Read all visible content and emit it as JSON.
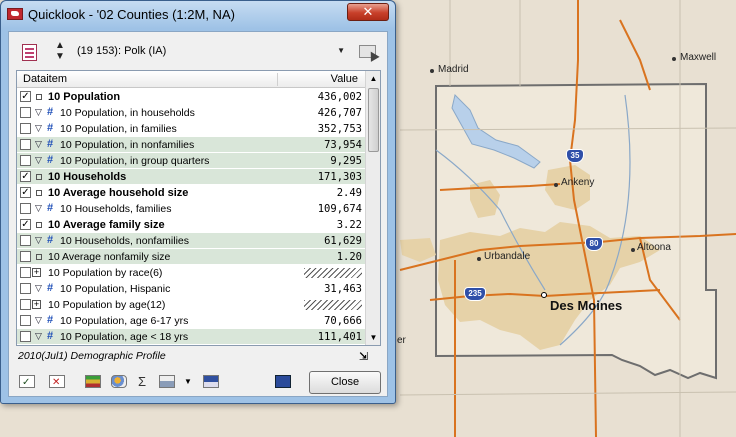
{
  "window": {
    "title": "Quicklook - '02 Counties (1:2M, NA)",
    "close_glyph": "✕"
  },
  "selector": {
    "value": "(19 153): Polk (IA)",
    "spin_up": "▲",
    "spin_down": "▼",
    "dropdown_arrow": "▼"
  },
  "grid": {
    "header_item": "Dataitem",
    "header_value": "Value",
    "rows": [
      {
        "checked": true,
        "expand": "",
        "icon": "sq",
        "label": "10 Population",
        "value": "436,002",
        "bold": true,
        "shade": false
      },
      {
        "checked": false,
        "expand": "▽",
        "icon": "hash",
        "label": "10 Population, in households",
        "value": "426,707",
        "bold": false,
        "shade": false
      },
      {
        "checked": false,
        "expand": "▽",
        "icon": "hash",
        "label": "10 Population, in families",
        "value": "352,753",
        "bold": false,
        "shade": false
      },
      {
        "checked": false,
        "expand": "▽",
        "icon": "hash",
        "label": "10 Population, in nonfamilies",
        "value": "73,954",
        "bold": false,
        "shade": true
      },
      {
        "checked": false,
        "expand": "▽",
        "icon": "hash",
        "label": "10 Population, in group quarters",
        "value": "9,295",
        "bold": false,
        "shade": true
      },
      {
        "checked": true,
        "expand": "",
        "icon": "sq",
        "label": "10 Households",
        "value": "171,303",
        "bold": true,
        "shade": true
      },
      {
        "checked": true,
        "expand": "",
        "icon": "sq",
        "label": "10 Average household size",
        "value": "2.49",
        "bold": true,
        "shade": false
      },
      {
        "checked": false,
        "expand": "▽",
        "icon": "hash",
        "label": "10 Households, families",
        "value": "109,674",
        "bold": false,
        "shade": false
      },
      {
        "checked": true,
        "expand": "",
        "icon": "sq",
        "label": "10 Average family size",
        "value": "3.22",
        "bold": true,
        "shade": false
      },
      {
        "checked": false,
        "expand": "▽",
        "icon": "hash",
        "label": "10 Households, nonfamilies",
        "value": "61,629",
        "bold": false,
        "shade": true
      },
      {
        "checked": false,
        "expand": "",
        "icon": "sq",
        "label": "10 Average nonfamily size",
        "value": "1.20",
        "bold": false,
        "shade": true,
        "plain": true
      },
      {
        "checked": false,
        "expand": "",
        "icon": "plus",
        "label": "10 Population by race(6)",
        "value": "",
        "bold": false,
        "shade": false,
        "plain": true,
        "hatch": true
      },
      {
        "checked": false,
        "expand": "▽",
        "icon": "hash",
        "label": "10 Population, Hispanic",
        "value": "31,463",
        "bold": false,
        "shade": false
      },
      {
        "checked": false,
        "expand": "",
        "icon": "plus",
        "label": "10 Population by age(12)",
        "value": "",
        "bold": false,
        "shade": false,
        "plain": true,
        "hatch": true
      },
      {
        "checked": false,
        "expand": "▽",
        "icon": "hash",
        "label": "10 Population, age 6-17 yrs",
        "value": "70,666",
        "bold": false,
        "shade": false
      },
      {
        "checked": false,
        "expand": "▽",
        "icon": "hash",
        "label": "10 Population, age < 18 yrs",
        "value": "111,401",
        "bold": false,
        "shade": true
      }
    ]
  },
  "status_text": "2010(Jul1) Demographic Profile",
  "toolbar": {
    "sigma": "Σ",
    "drop": "▼",
    "close_label": "Close"
  },
  "map": {
    "cities": [
      "Madrid",
      "Maxwell",
      "Ankeny",
      "Urbandale",
      "Altoona",
      "Des Moines"
    ],
    "shields": [
      "35",
      "80",
      "235"
    ],
    "partial_label": "er"
  },
  "colors": {
    "map_bg": "#e8e0d2",
    "urban": "#e6d2a8",
    "road": "#d9731f",
    "county_border": "#7a7a7a",
    "shade_row": "#d9e6d9"
  }
}
